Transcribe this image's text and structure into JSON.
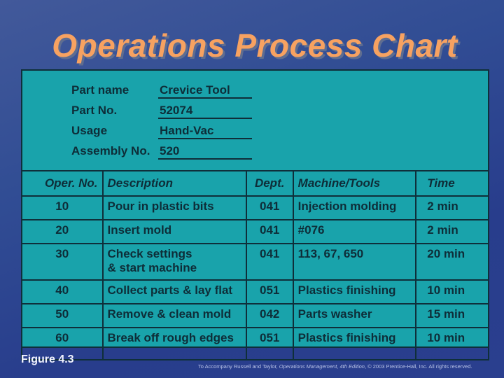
{
  "title": "Operations Process Chart",
  "part_info": [
    {
      "label": "Part name",
      "value": "Crevice Tool"
    },
    {
      "label": "Part No.",
      "value": "52074"
    },
    {
      "label": "Usage",
      "value": "Hand-Vac"
    },
    {
      "label": "Assembly No.",
      "value": "520"
    }
  ],
  "table": {
    "headers": {
      "oper_no": "Oper. No.",
      "description": "Description",
      "dept": "Dept.",
      "machine_tools": "Machine/Tools",
      "time": "Time"
    },
    "rows": [
      {
        "oper_no": "10",
        "description": "Pour in plastic bits",
        "dept": "041",
        "machine_tools": "Injection molding",
        "time": "2 min"
      },
      {
        "oper_no": "20",
        "description": "Insert mold",
        "dept": "041",
        "machine_tools": "#076",
        "time": "2 min"
      },
      {
        "oper_no": "30",
        "description_line1": "Check settings",
        "description_line2": "& start machine",
        "dept": "041",
        "machine_tools": "113, 67, 650",
        "time": "20 min"
      },
      {
        "oper_no": "40",
        "description": "Collect parts & lay flat",
        "dept": "051",
        "machine_tools": "Plastics finishing",
        "time": "10 min"
      },
      {
        "oper_no": "50",
        "description": "Remove & clean mold",
        "dept": "042",
        "machine_tools": "Parts washer",
        "time": "15 min"
      },
      {
        "oper_no": "60",
        "description": "Break off rough edges",
        "dept": "051",
        "machine_tools": "Plastics finishing",
        "time": "10 min"
      }
    ]
  },
  "figure_label": "Figure 4.3",
  "footer": {
    "prefix": "To Accompany Russell and Taylor, ",
    "book": "Operations Management, 4th Edition",
    "suffix": ", © 2003 Prentice-Hall, Inc. All rights reserved."
  },
  "colors": {
    "title": "#f7a261",
    "panel": "#19a3ab",
    "text": "#0e2d38",
    "background": "#2f4a92"
  }
}
